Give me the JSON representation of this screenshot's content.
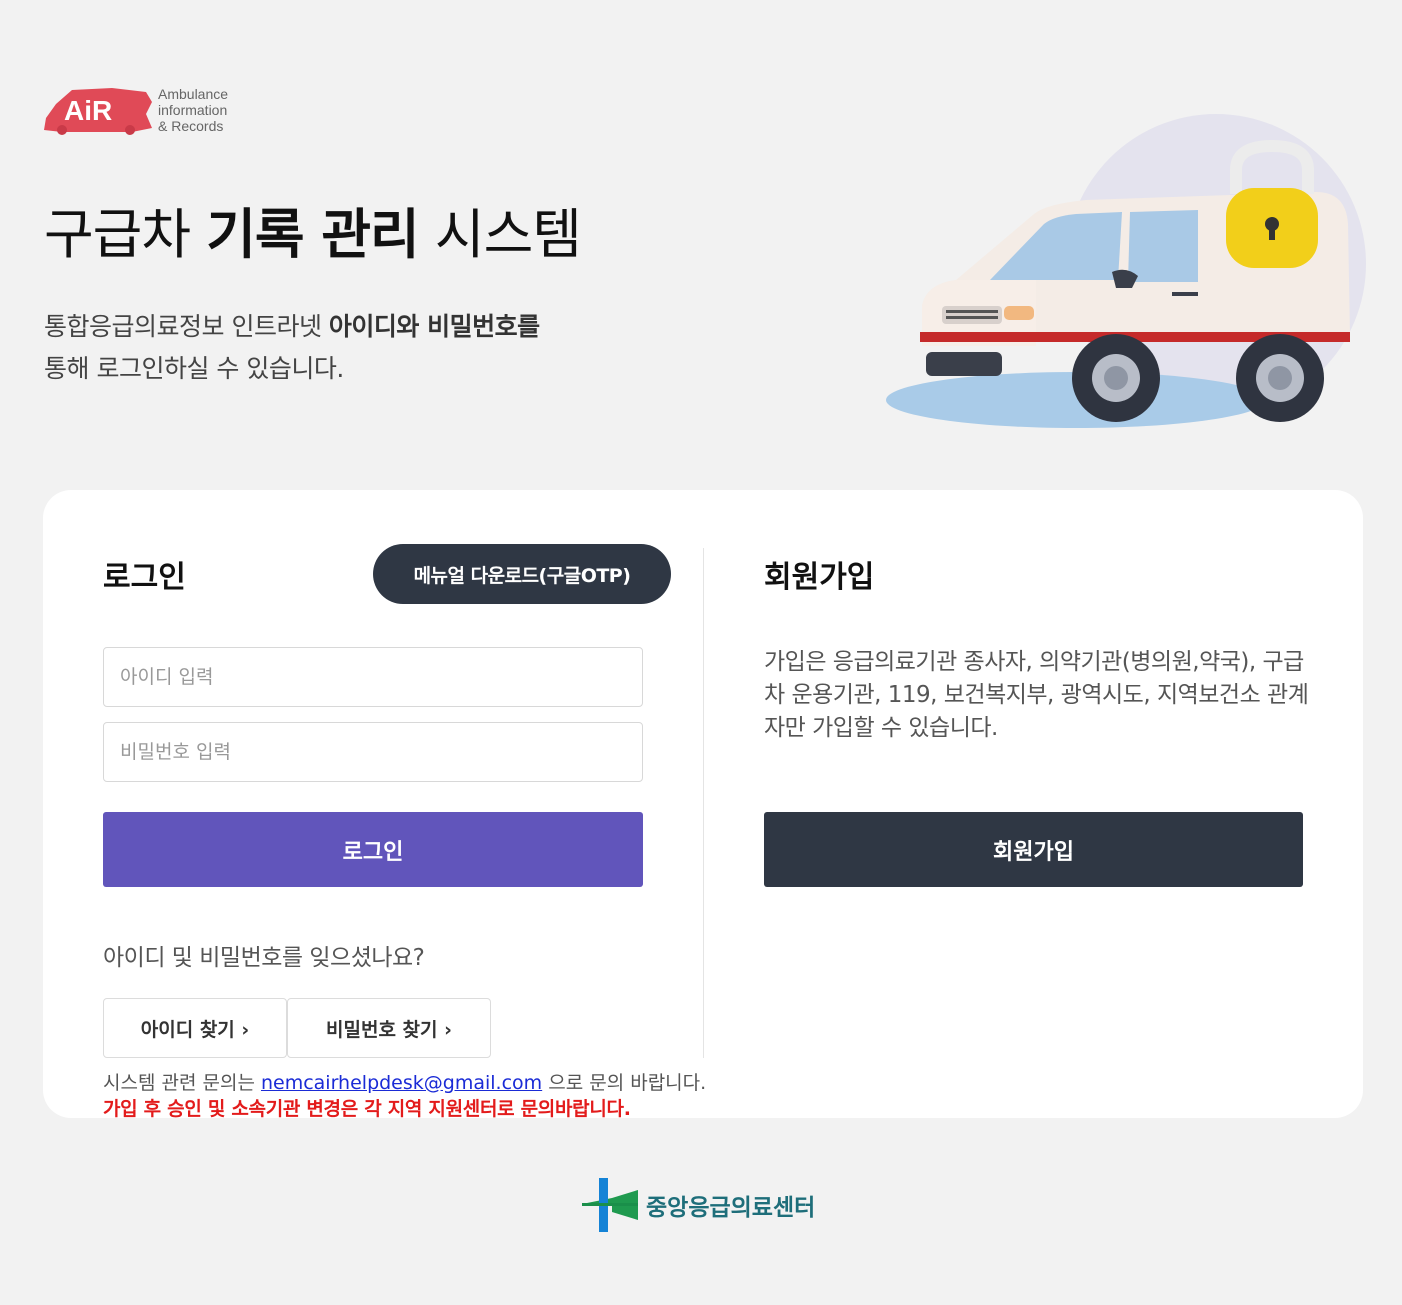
{
  "logo": {
    "mark": "AiR",
    "line1": "Ambulance",
    "line2": "information",
    "line3": "& Records"
  },
  "header": {
    "title_pre": "구급차 ",
    "title_bold": "기록 관리",
    "title_post": " 시스템",
    "subtitle_line1_pre": "통합응급의료정보 인트라넷 ",
    "subtitle_line1_bold": "아이디와 비밀번호를",
    "subtitle_line2": "통해 로그인하실 수 있습니다."
  },
  "login": {
    "heading": "로그인",
    "manual_button": "메뉴얼 다운로드(구글OTP)",
    "id_placeholder": "아이디 입력",
    "pw_placeholder": "비밀번호 입력",
    "submit": "로그인",
    "forgot": "아이디 및 비밀번호를 잊으셨나요?",
    "find_id": "아이디 찾기 ›",
    "find_pw": "비밀번호 찾기 ›",
    "contact_pre": "시스템 관련 문의는 ",
    "contact_email": "nemcairhelpdesk@gmail.com",
    "contact_post": " 으로 문의 바랍니다.",
    "notice": "가입 후 승인 및 소속기관 변경은 각 지역 지원센터로 문의바랍니다."
  },
  "signup": {
    "heading": "회원가입",
    "description": "가입은 응급의료기관 종사자, 의약기관(병의원,약국), 구급차 운용기관, 119, 보건복지부, 광역시도, 지역보건소 관계자만 가입할 수 있습니다.",
    "button": "회원가입"
  },
  "footer": {
    "org_name": "중앙응급의료센터"
  },
  "colors": {
    "primary": "#6155bb",
    "dark": "#2f3744",
    "notice": "#e31b1b",
    "link": "#1a2bd6",
    "logo_red": "#e04a57"
  },
  "icons": {
    "hero": "ambulance-lock-illustration",
    "footer": "medical-center-logo"
  }
}
